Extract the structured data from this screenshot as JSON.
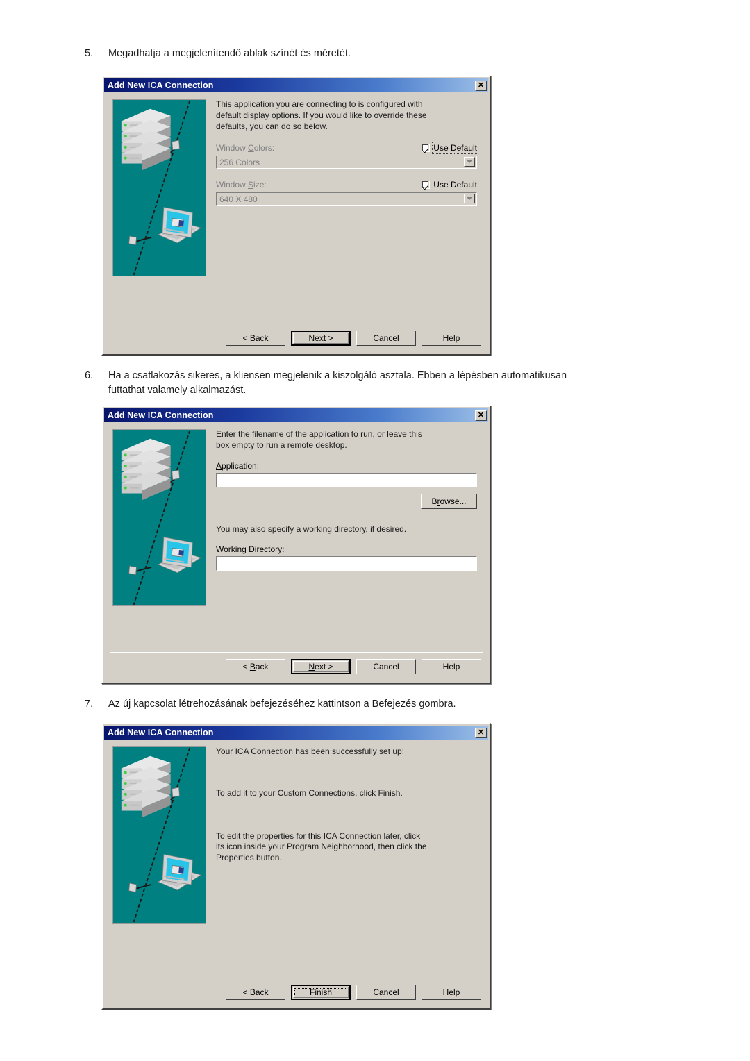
{
  "document": {
    "language": "hu",
    "steps": [
      {
        "number": "5.",
        "text": "Megadhatja a megjelenítendő ablak színét és méretét."
      },
      {
        "number": "6.",
        "text": "Ha a csatlakozás sikeres, a kliensen megjelenik a kiszolgáló asztala. Ebben a lépésben automatikusan futtathat valamely alkalmazást."
      },
      {
        "number": "7.",
        "text": "Az új kapcsolat létrehozásának befejezéséhez kattintson a Befejezés gombra."
      }
    ]
  },
  "colors": {
    "dialog_face": "#d4d0c8",
    "titlebar_dark": "#08146b",
    "titlebar_light": "#9dc0e8",
    "illustration_bg": "#008080",
    "disabled_text": "#808080",
    "laptop_screen": "#29c5e8"
  },
  "dialogs": [
    {
      "id": "display-options",
      "title": "Add New ICA Connection",
      "close_label": "✕",
      "body_text": "This application you are connecting to is configured with\ndefault display options.  If you would like to override these\ndefaults, you can do so below.",
      "fields": [
        {
          "label_pre": "Window ",
          "label_key": "C",
          "label_post": "olors:",
          "checkbox_label": "Use Default",
          "checked": true,
          "focused": true,
          "value": "256 Colors"
        },
        {
          "label_pre": "Window ",
          "label_key": "S",
          "label_post": "ize:",
          "checkbox_label": "Use Default",
          "checked": true,
          "focused": false,
          "value": "640 X 480"
        }
      ],
      "buttons": [
        {
          "pre": "< ",
          "key": "B",
          "post": "ack",
          "default": false,
          "focus": false
        },
        {
          "pre": "",
          "key": "N",
          "post": "ext >",
          "default": true,
          "focus": false
        },
        {
          "pre": "Cancel",
          "key": "",
          "post": "",
          "default": false,
          "focus": false
        },
        {
          "pre": "Help",
          "key": "",
          "post": "",
          "default": false,
          "focus": false
        }
      ]
    },
    {
      "id": "application-settings",
      "title": "Add New ICA Connection",
      "close_label": "✕",
      "body_text": "Enter the filename of the application to run, or leave this\nbox empty to run a remote desktop.",
      "application_label_pre": "",
      "application_label_key": "A",
      "application_label_post": "pplication:",
      "application_value": "",
      "browse_pre": "B",
      "browse_key": "r",
      "browse_post": "owse...",
      "working_note": "You may also specify a working directory, if desired.",
      "working_label_pre": "",
      "working_label_key": "W",
      "working_label_post": "orking Directory:",
      "working_value": "",
      "buttons": [
        {
          "pre": "< ",
          "key": "B",
          "post": "ack",
          "default": false,
          "focus": false
        },
        {
          "pre": "",
          "key": "N",
          "post": "ext >",
          "default": true,
          "focus": false
        },
        {
          "pre": "Cancel",
          "key": "",
          "post": "",
          "default": false,
          "focus": false
        },
        {
          "pre": "Help",
          "key": "",
          "post": "",
          "default": false,
          "focus": false
        }
      ]
    },
    {
      "id": "finish",
      "title": "Add New ICA Connection",
      "close_label": "✕",
      "body_text": "Your ICA Connection has been successfully set up!",
      "body_text2": "To add it to your Custom Connections, click Finish.",
      "body_text3": "To edit the properties for this ICA Connection later, click\nits icon inside your Program Neighborhood, then click the\nProperties button.",
      "buttons": [
        {
          "pre": "< ",
          "key": "B",
          "post": "ack",
          "default": false,
          "focus": false
        },
        {
          "pre": "Finish",
          "key": "",
          "post": "",
          "default": true,
          "focus": true
        },
        {
          "pre": "Cancel",
          "key": "",
          "post": "",
          "default": false,
          "focus": false
        },
        {
          "pre": "Help",
          "key": "",
          "post": "",
          "default": false,
          "focus": false
        }
      ]
    }
  ]
}
